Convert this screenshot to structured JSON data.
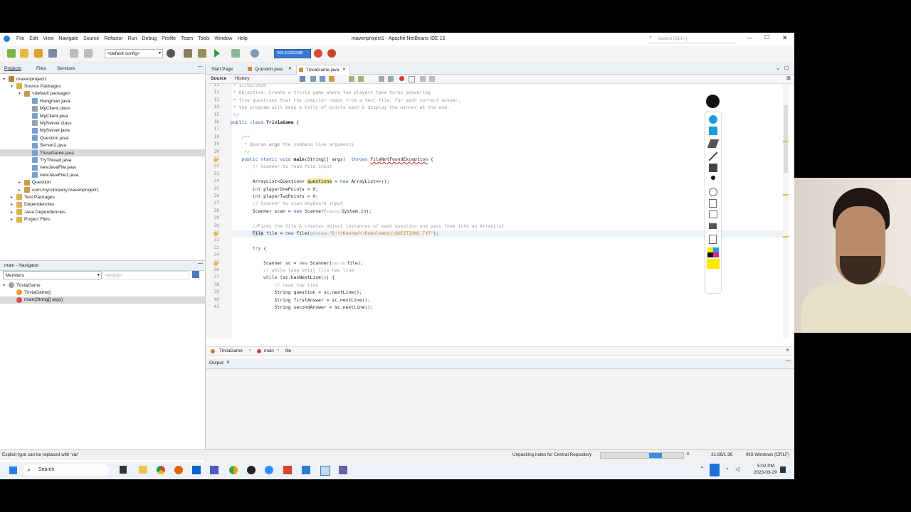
{
  "window": {
    "title": "mavenproject1 - Apache NetBeans IDE 15",
    "search_placeholder": "Search (Ctrl+I)"
  },
  "menu": [
    "File",
    "Edit",
    "View",
    "Navigate",
    "Source",
    "Refactor",
    "Run",
    "Debug",
    "Profile",
    "Team",
    "Tools",
    "Window",
    "Help"
  ],
  "toolbar": {
    "config": "<default config>",
    "memory": "499.6/1352MB"
  },
  "left": {
    "tabs": [
      "Projects",
      "Files",
      "Services"
    ],
    "tree": [
      {
        "label": "mavenproject1",
        "level": 0,
        "tw": "▾",
        "icon": "project"
      },
      {
        "label": "Source Packages",
        "level": 1,
        "tw": "▾",
        "icon": "folder"
      },
      {
        "label": "<default package>",
        "level": 2,
        "tw": "▾",
        "icon": "package"
      },
      {
        "label": "Hangman.java",
        "level": 3,
        "tw": "",
        "icon": "java"
      },
      {
        "label": "MyClient.class",
        "level": 3,
        "tw": "",
        "icon": "class"
      },
      {
        "label": "MyClient.java",
        "level": 3,
        "tw": "",
        "icon": "java"
      },
      {
        "label": "MyServer.class",
        "level": 3,
        "tw": "",
        "icon": "class"
      },
      {
        "label": "MyServer.java",
        "level": 3,
        "tw": "",
        "icon": "java"
      },
      {
        "label": "Question.java",
        "level": 3,
        "tw": "",
        "icon": "java"
      },
      {
        "label": "Server2.java",
        "level": 3,
        "tw": "",
        "icon": "java"
      },
      {
        "label": "TriviaGame.java",
        "level": 3,
        "tw": "",
        "icon": "java",
        "selected": true
      },
      {
        "label": "TryThread.java",
        "level": 3,
        "tw": "",
        "icon": "java"
      },
      {
        "label": "newJavaFile.java",
        "level": 3,
        "tw": "",
        "icon": "java"
      },
      {
        "label": "newJavaFile1.java",
        "level": 3,
        "tw": "",
        "icon": "java"
      },
      {
        "label": "Question",
        "level": 2,
        "tw": "▸",
        "icon": "package"
      },
      {
        "label": "com.mycompany.mavenproject1",
        "level": 2,
        "tw": "▸",
        "icon": "package"
      },
      {
        "label": "Test Packages",
        "level": 1,
        "tw": "▸",
        "icon": "folder"
      },
      {
        "label": "Dependencies",
        "level": 1,
        "tw": "▸",
        "icon": "folder"
      },
      {
        "label": "Java Dependencies",
        "level": 1,
        "tw": "▸",
        "icon": "folder"
      },
      {
        "label": "Project Files",
        "level": 1,
        "tw": "▸",
        "icon": "folder"
      }
    ],
    "navigator_title": "main - Navigator",
    "members_label": "Members",
    "empty_label": "<empty>",
    "nav_tree": [
      {
        "label": "TriviaGame",
        "level": 0,
        "tw": "▾",
        "icon": "class"
      },
      {
        "label": "TriviaGame()",
        "level": 1,
        "tw": "",
        "icon": "ctor"
      },
      {
        "label": "main(String[] args)",
        "level": 1,
        "tw": "",
        "icon": "method",
        "selected": true
      }
    ]
  },
  "editor": {
    "tabs": [
      "Start Page",
      "Question.java",
      "TriviaGame.java"
    ],
    "subtabs": [
      "Source",
      "History"
    ],
    "breadcrumbs": [
      "TriviaGame",
      "main",
      "file"
    ],
    "lines": [
      {
        "n": "11",
        "html": "<span class='cm'> * 11/01/2020</span>"
      },
      {
        "n": "12",
        "html": "<span class='cm'> * Objective: Create a trivia game where two players take turns answering</span>"
      },
      {
        "n": "13",
        "html": "<span class='cm'> * five questions that the compiler reads from a text file. For each correct answer,</span>"
      },
      {
        "n": "14",
        "html": "<span class='cm'> * the program will keep a tally of points each & display the winner at the end.</span>"
      },
      {
        "n": "15",
        "html": "<span class='cm'> */</span>"
      },
      {
        "n": "16",
        "html": "<span class='kw'>public class</span> <b>TriviaGame</b> {"
      },
      {
        "n": "17",
        "html": ""
      },
      {
        "n": "18",
        "html": "    <span class='cm'>/**</span>"
      },
      {
        "n": "19",
        "html": "    <span class='cm'> * @param <b>args</b> the command line arguments</span>"
      },
      {
        "n": "20",
        "html": "    <span class='cm'> */</span>"
      },
      {
        "n": "21",
        "html": "    <span class='kw'>public static void</span> <b>main</b>(String[] args)  <span class='kw'>throws</span> <span class='err'>FileNotFoundException</span> {"
      },
      {
        "n": "22",
        "html": "        <span class='cm'>// Scanner to read file input</span>"
      },
      {
        "n": "23",
        "html": ""
      },
      {
        "n": "24",
        "html": "        ArrayList&lt;Question&gt; <span class='hl'>questions</span> = <span class='kw'>new</span> ArrayList&lt;&gt;();"
      },
      {
        "n": "25",
        "html": "        <span class='kw'>int</span> playerOnePoints = 0;"
      },
      {
        "n": "26",
        "html": "        <span class='kw'>int</span> playerTwoPoints = 0;"
      },
      {
        "n": "27",
        "html": "        <span class='cm'>// Scanner to scan keyboard input</span>"
      },
      {
        "n": "28",
        "html": "        Scanner scan = <span class='kw'>new</span> Scanner(<span class='hint'>source:</span>System.<i>in</i>);"
      },
      {
        "n": "29",
        "html": ""
      },
      {
        "n": "30",
        "html": "        <span class='cm'>//Finds the file & creates object instances of each question and pass them into an ArrayList</span>"
      },
      {
        "n": "31",
        "html": "        <span style='background:#cfe0f7'>File</span> file = <span class='kw'>new</span> File(<span class='hint'>pathname:</span><span class='str'>\"D:\\\\Kashan\\\\Downloads\\\\QUESTIONS.TXT\"</span>);"
      },
      {
        "n": "32",
        "html": ""
      },
      {
        "n": "33",
        "html": "        <span class='kw'>try</span> {"
      },
      {
        "n": "34",
        "html": ""
      },
      {
        "n": "35",
        "html": "            Scanner sc = <span class='kw'>new</span> Scanner(<span class='hint'>source:</span>file);"
      },
      {
        "n": "36",
        "html": "            <span class='cm'>// while loop until file has line</span>"
      },
      {
        "n": "37",
        "html": "            <span class='kw'>while</span> (sc.hasNextLine()) {"
      },
      {
        "n": "38",
        "html": "                <span class='cm'>// read the line</span>"
      },
      {
        "n": "39",
        "html": "                String question = sc.nextLine();"
      },
      {
        "n": "40",
        "html": "                String firstAnswer = sc.nextLine();"
      },
      {
        "n": "41",
        "html": "                String secondAnswer = sc.nextLine();"
      }
    ]
  },
  "output": {
    "tab": "Output"
  },
  "status": {
    "hint": "Explicit type can be replaced with 'var'",
    "task": "Unpacking index for Central Repository",
    "position": "31:66/1:36",
    "mode": "INS Windows (CRLF)"
  },
  "taskbar": {
    "search": "Search",
    "time": "5:02 PM",
    "date": "2023-03-29"
  }
}
